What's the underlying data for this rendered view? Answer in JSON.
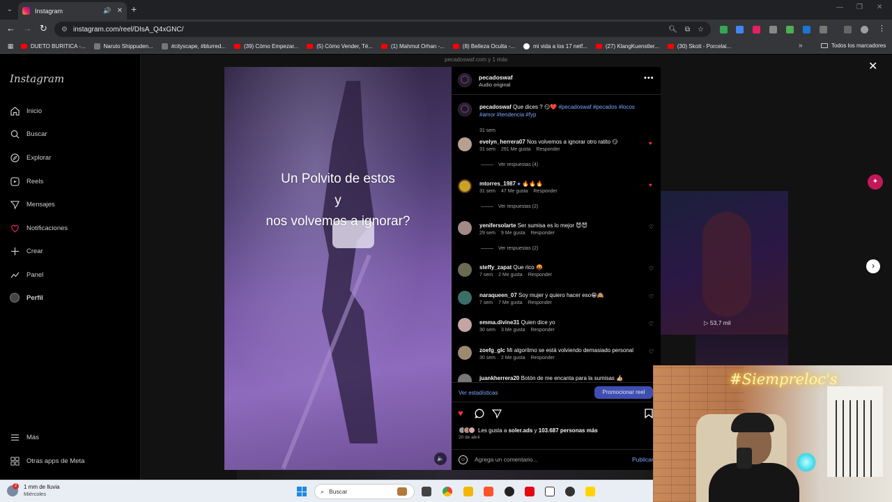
{
  "browser": {
    "tab_title": "Instagram",
    "url": "instagram.com/reel/DIsA_Q4xGNC/",
    "bookmarks": [
      {
        "label": "DUETO BURITICA -...",
        "icon": "youtube"
      },
      {
        "label": "Naruto Shippuden...",
        "icon": "other"
      },
      {
        "label": "#cityscape, #blurred...",
        "icon": "other"
      },
      {
        "label": "(39) Cómo Empezar...",
        "icon": "youtube"
      },
      {
        "label": "(5) Cómo Vender, Té...",
        "icon": "youtube"
      },
      {
        "label": "(1) Mahmut Orhan -...",
        "icon": "youtube"
      },
      {
        "label": "(8) Belleza Oculta -...",
        "icon": "youtube"
      },
      {
        "label": "mi vida a los 17 netf...",
        "icon": "google"
      },
      {
        "label": "(27) KlangKuenstler...",
        "icon": "youtube"
      },
      {
        "label": "(30) Skott - Porcelai...",
        "icon": "youtube"
      }
    ],
    "all_bookmarks": "Todos los marcadores"
  },
  "instagram": {
    "logo": "Instagram",
    "nav": [
      {
        "label": "Inicio",
        "icon": "home-icon"
      },
      {
        "label": "Buscar",
        "icon": "search-icon"
      },
      {
        "label": "Explorar",
        "icon": "compass-icon"
      },
      {
        "label": "Reels",
        "icon": "reels-icon"
      },
      {
        "label": "Mensajes",
        "icon": "messages-icon"
      },
      {
        "label": "Notificaciones",
        "icon": "heart-icon"
      },
      {
        "label": "Crear",
        "icon": "plus-icon"
      },
      {
        "label": "Panel",
        "icon": "dashboard-icon"
      },
      {
        "label": "Perfil",
        "icon": "profile-avatar"
      }
    ],
    "more": "Más",
    "meta_apps": "Otras apps de Meta"
  },
  "reel": {
    "handle_above": "pecadoswaf.com y 1 más",
    "caption_lines": [
      "Un Polvito  de estos",
      "y",
      "nos volvemos a ignorar?"
    ],
    "author": "pecadoswaf",
    "audio": "Audio original",
    "post": {
      "user": "pecadoswaf",
      "text": "Que dices ? 😏❤️",
      "tags": "#pecadoswaf #pecados #locos #amor #tendencia #fyp",
      "time": "31 sem"
    },
    "comments": [
      {
        "user": "evelyn_herrera07",
        "text": "Nos volvemos a ignorar otro ratito 😏",
        "time": "31 sem",
        "likes": "291 Me gusta",
        "reply": "Responder",
        "replies": "Ver respuestas (4)",
        "liked": true
      },
      {
        "user": "mtorres_1987",
        "text": "🔥🔥🔥",
        "time": "31 sem",
        "likes": "47 Me gusta",
        "reply": "Responder",
        "replies": "Ver respuestas (2)",
        "liked": true
      },
      {
        "user": "yenifersolarte",
        "text": "Ser sumisa es lo mejor 😈😈",
        "time": "29 sem",
        "likes": "9 Me gusta",
        "reply": "Responder",
        "replies": "Ver respuestas (2)",
        "liked": false
      },
      {
        "user": "steffy_zapat",
        "text": "Que rico 🤬",
        "time": "7 sem",
        "likes": "2 Me gusta",
        "reply": "Responder",
        "replies": "",
        "liked": false
      },
      {
        "user": "naraqueen_07",
        "text": "Soy mujer y quiero hacer eso😁🙈",
        "time": "7 sem",
        "likes": "7 Me gusta",
        "reply": "Responder",
        "replies": "",
        "liked": false
      },
      {
        "user": "emma.divine31",
        "text": "Quien dice yo",
        "time": "30 sem",
        "likes": "3 Me gusta",
        "reply": "Responder",
        "replies": "",
        "liked": false
      },
      {
        "user": "zoefg_glc",
        "text": "Mi algoritmo se está volviendo demasiado personal",
        "time": "30 sem",
        "likes": "2 Me gusta",
        "reply": "Responder",
        "replies": "",
        "liked": false
      },
      {
        "user": "juankherrera20",
        "text": "Botón de me encanta para la sumisas 👍🏼",
        "time": "",
        "likes": "",
        "reply": "",
        "replies": "",
        "liked": false
      }
    ],
    "stats_link": "Ver estadísticas",
    "promote_button": "Promocionar reel",
    "likes_user": "soler.ads",
    "likes_count": "103.687 personas más",
    "likes_prefix": "Les gusta a",
    "likes_mid": "y",
    "date": "20 de abril",
    "comment_placeholder": "Agrega un comentario...",
    "publish": "Publicar"
  },
  "background_reel": {
    "views": "53,7 mil"
  },
  "webcam": {
    "neon_text": "#Siempreloc's"
  },
  "taskbar": {
    "weather_title": "1 mm de lluvia",
    "weather_day": "Miércoles",
    "weather_badge": "2",
    "search_placeholder": "Buscar"
  }
}
